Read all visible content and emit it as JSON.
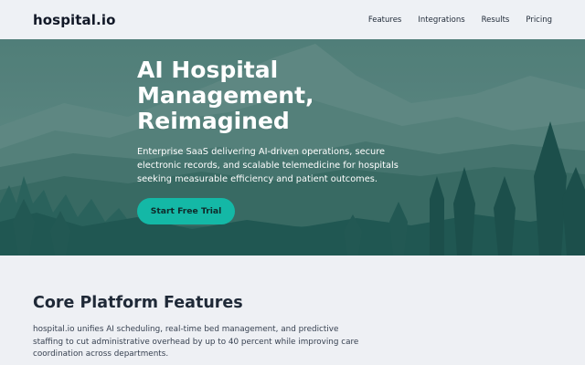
{
  "brand": "hospital.io",
  "nav": {
    "items": [
      {
        "label": "Features"
      },
      {
        "label": "Integrations"
      },
      {
        "label": "Results"
      },
      {
        "label": "Pricing"
      }
    ]
  },
  "hero": {
    "title": "AI Hospital Management, Reimagined",
    "subtitle": "Enterprise SaaS delivering AI-driven operations, secure electronic records, and scalable telemedicine for hospitals seeking measurable efficiency and patient outcomes.",
    "cta_label": "Start Free Trial"
  },
  "features": {
    "title": "Core Platform Features",
    "description": "hospital.io unifies AI scheduling, real-time bed management, and predictive staffing to cut administrative overhead by up to 40 percent while improving care coordination across departments."
  },
  "colors": {
    "accent": "#14b8a6",
    "hero_sky": "#5f8f8a",
    "hero_forest": "#1d5a55"
  }
}
